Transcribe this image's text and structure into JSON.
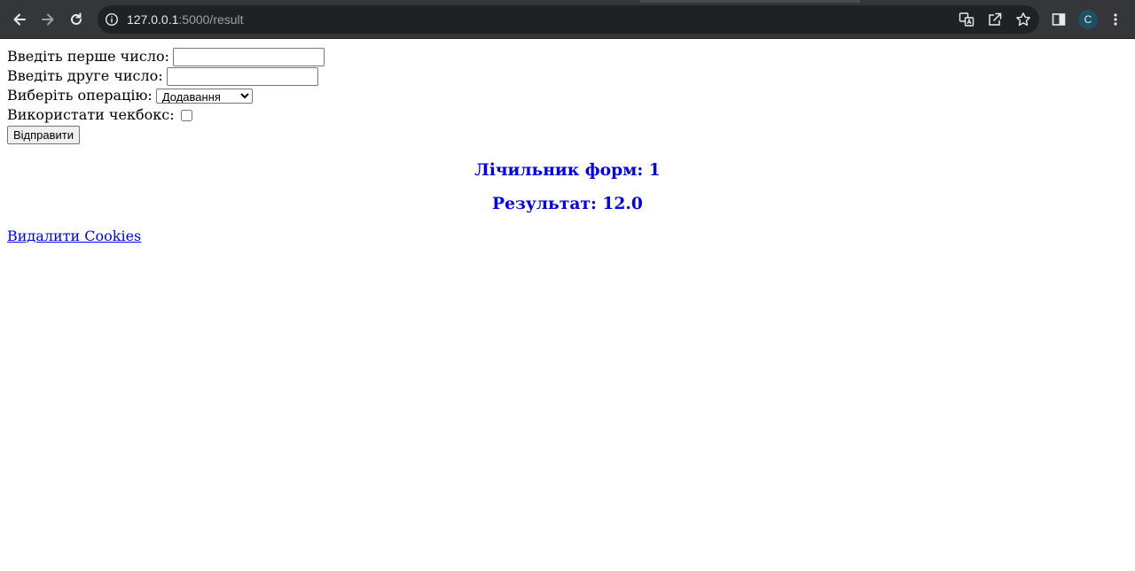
{
  "browser": {
    "url_host": "127.0.0.1",
    "url_rest": ":5000/result",
    "profile_initial": "C",
    "icons": [
      "back-icon",
      "forward-icon",
      "reload-icon",
      "info-icon",
      "translate-icon",
      "share-icon",
      "bookmark-star-icon",
      "side-panel-icon",
      "menu-icon"
    ]
  },
  "form": {
    "first_label": "Введіть перше число:",
    "first_value": "",
    "second_label": "Введіть друге число:",
    "second_value": "",
    "operation_label": "Виберіть операцію:",
    "operation_selected": "Додавання",
    "checkbox_label": "Використати чекбокс:",
    "checkbox_checked": false,
    "submit_label": "Відправити"
  },
  "output": {
    "counter": "Лічильник форм: 1",
    "result": "Результат: 12.0"
  },
  "link": {
    "delete_cookies": "Видалити Cookies"
  },
  "colors": {
    "heading": "#0000ee",
    "link": "#0000ee",
    "chrome_bg": "#35363a",
    "omnibox_bg": "#202124"
  }
}
